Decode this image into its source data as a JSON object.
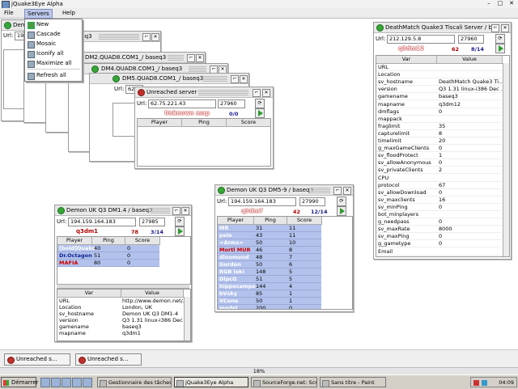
{
  "app": {
    "title": "jQuake3Eye Alpha"
  },
  "menus": [
    "File",
    "Servers",
    "Help"
  ],
  "servers_menu": [
    "New",
    "Cascade",
    "Mosaic",
    "Iconify all",
    "Maximize all",
    "Refresh all"
  ],
  "url_label": "Url:",
  "cascade": [
    {
      "title": "Demon",
      "url": "194.1"
    },
    {
      "title": "baseq3",
      "url": ""
    },
    {
      "title": "DM2.QUAD8.COM1_/ baseq3",
      "url": ""
    },
    {
      "title": "DM4.QUAD8.COM1_/ baseq3",
      "url": ""
    },
    {
      "title": "DM5.QUAD8.COM1_/ baseq3",
      "url": "62.2"
    }
  ],
  "unreached": {
    "title": "Unreached server",
    "url": "62.75.221.43",
    "port": "27960",
    "map": "Unknown map",
    "count": "0/0",
    "cols": [
      "Player",
      "Ping",
      "Score"
    ]
  },
  "server_dm14": {
    "title": "Demon UK Q3 DM1.4 / baseq3",
    "url": "194.159.164.183",
    "port": "27985",
    "map": "q3dm1",
    "ping": "78",
    "count": "3/14",
    "cols": [
      "Player",
      "Ping",
      "Score"
    ],
    "players": [
      {
        "name": "[bold]Quake",
        "ping": "40",
        "score": "0"
      },
      {
        "name": "Dr.Octagon",
        "ping": "51",
        "score": "0"
      },
      {
        "name": "MAFIA",
        "ping": "80",
        "score": "0"
      }
    ],
    "var_cols": [
      "Var",
      "Value"
    ],
    "vars": [
      [
        "URL",
        "http://www.demon.net/..."
      ],
      [
        "Location",
        "London, UK"
      ],
      [
        "sv_hostname",
        "Demon UK Q3 DM1-4"
      ],
      [
        "version",
        "Q3 1.31 linux-i386 Dec ..."
      ],
      [
        "gamename",
        "baseq3"
      ],
      [
        "mapname",
        "q3dm1"
      ]
    ]
  },
  "server_dm59": {
    "title": "Demon UK Q3 DM5-9 / baseq3",
    "url": "194.159.164.183",
    "port": "27990",
    "map": "q3dm7",
    "ping": "42",
    "count": "12/14",
    "cols": [
      "Player",
      "Ping",
      "Score"
    ],
    "players": [
      {
        "name": "MR",
        "ping": "31",
        "score": "11"
      },
      {
        "name": "pele",
        "ping": "43",
        "score": "11"
      },
      {
        "name": "=Arms=",
        "ping": "50",
        "score": "10"
      },
      {
        "name": "Mortl MUR",
        "ping": "46",
        "score": "8"
      },
      {
        "name": "dinomond",
        "ping": "48",
        "score": "7"
      },
      {
        "name": "Gordon",
        "ping": "50",
        "score": "6"
      },
      {
        "name": "RGB loki",
        "ping": "148",
        "score": "5"
      },
      {
        "name": "DlpcG",
        "ping": "51",
        "score": "5"
      },
      {
        "name": "hippocampe",
        "ping": "144",
        "score": "4"
      },
      {
        "name": "bVsky",
        "ping": "85",
        "score": "1"
      },
      {
        "name": "VCone",
        "ping": "50",
        "score": "1"
      },
      {
        "name": "model",
        "ping": "200",
        "score": "0"
      }
    ]
  },
  "server_tiscali": {
    "title": "DeathMatch Quake3 Tiscali Server / b...",
    "url": "212.129.5.8",
    "port": "27960",
    "map": "q3dm12",
    "ping": "62",
    "count": "8/14",
    "var_cols": [
      "Var",
      "Value"
    ],
    "vars": [
      [
        "URL",
        ""
      ],
      [
        "Location",
        ""
      ],
      [
        "sv_hostname",
        "DeathMatch Quake3 Ti..."
      ],
      [
        "version",
        "Q3 1.31 linux-i386 Dec ..."
      ],
      [
        "gamename",
        "baseq3"
      ],
      [
        "mapname",
        "q3dm12"
      ],
      [
        "dmflags",
        "0"
      ],
      [
        "mappack",
        ""
      ],
      [
        "fraglimit",
        "35"
      ],
      [
        "capturelimit",
        "8"
      ],
      [
        "timelimit",
        "20"
      ],
      [
        "g_maxGameClients",
        "0"
      ],
      [
        "sv_floodProtect",
        "1"
      ],
      [
        "sv_allowAnonymous",
        "0"
      ],
      [
        "sv_privateClients",
        "2"
      ],
      [
        "CPU",
        ""
      ],
      [
        "protocol",
        "67"
      ],
      [
        "sv_allowDownload",
        "0"
      ],
      [
        "sv_maxclients",
        "16"
      ],
      [
        "sv_minPing",
        "0"
      ],
      [
        "bot_minplayers",
        ""
      ],
      [
        "g_needpass",
        "0"
      ],
      [
        "sv_maxRate",
        "8000"
      ],
      [
        "sv_maxPing",
        "0"
      ],
      [
        "g_gametype",
        "0"
      ],
      [
        "Email",
        ""
      ]
    ]
  },
  "iconified": [
    "Unreached s...",
    "Unreached s..."
  ],
  "status": "18%",
  "taskbar": {
    "start": "Démarrer",
    "items": [
      "Gestionnaire des tâches ...",
      "jQuake3Eye Alpha",
      "SourceForge.net: Scree...",
      "Sans titre - Paint"
    ],
    "clock": "04:09"
  }
}
